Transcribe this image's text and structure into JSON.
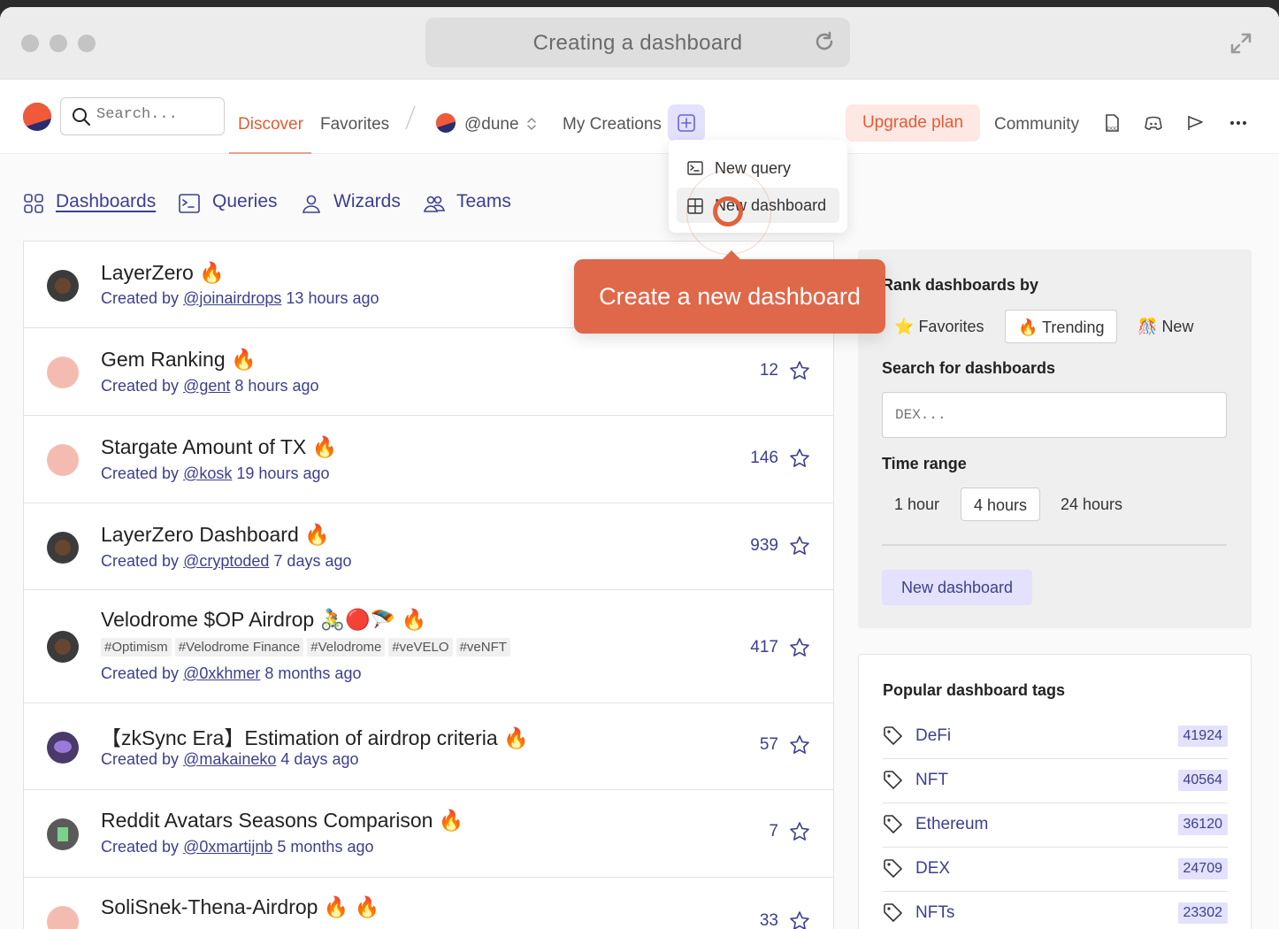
{
  "browser": {
    "title": "Creating a dashboard"
  },
  "nav": {
    "search_placeholder": "Search...",
    "discover": "Discover",
    "favorites": "Favorites",
    "team": "@dune",
    "my_creations": "My Creations",
    "upgrade": "Upgrade plan",
    "community": "Community"
  },
  "dropdown": {
    "items": [
      {
        "label": "New query",
        "icon": "terminal-icon"
      },
      {
        "label": "New dashboard",
        "icon": "grid-icon"
      }
    ]
  },
  "tooltip": {
    "text": "Create a new dashboard"
  },
  "tabs": [
    {
      "label": "Dashboards",
      "icon": "dashboards-icon",
      "active": true
    },
    {
      "label": "Queries",
      "icon": "queries-icon"
    },
    {
      "label": "Wizards",
      "icon": "user-icon"
    },
    {
      "label": "Teams",
      "icon": "team-icon"
    }
  ],
  "dashboards": [
    {
      "title": "LayerZero",
      "emoji": "🔥",
      "by": "Created by",
      "user": "@joinairdrops",
      "ago": "13 hours ago",
      "count": ""
    },
    {
      "title": "Gem Ranking",
      "emoji": "🔥",
      "by": "Created by",
      "user": "@gent",
      "ago": "8 hours ago",
      "count": "12"
    },
    {
      "title": "Stargate Amount of TX",
      "emoji": "🔥",
      "by": "Created by",
      "user": "@kosk",
      "ago": "19 hours ago",
      "count": "146"
    },
    {
      "title": "LayerZero Dashboard",
      "emoji": "🔥",
      "by": "Created by",
      "user": "@cryptoded",
      "ago": "7 days ago",
      "count": "939"
    },
    {
      "title": "Velodrome $OP Airdrop",
      "emoji": "🚴🔴🪂 🔥",
      "tags": [
        "#Optimism",
        "#Velodrome Finance",
        "#Velodrome",
        "#veVELO",
        "#veNFT"
      ],
      "by": "Created by",
      "user": "@0xkhmer",
      "ago": "8 months ago",
      "count": "417"
    },
    {
      "title": "【zkSync Era】Estimation of airdrop criteria",
      "emoji": "🔥",
      "by": "Created by",
      "user": "@makaineko",
      "ago": "4 days ago",
      "count": "57"
    },
    {
      "title": "Reddit Avatars Seasons Comparison",
      "emoji": "🔥",
      "by": "Created by",
      "user": "@0xmartijnb",
      "ago": "5 months ago",
      "count": "7"
    },
    {
      "title": "SoliSnek-Thena-Airdrop",
      "emoji": "🔥 🔥",
      "by": "",
      "user": "",
      "ago": "",
      "count": "33"
    }
  ],
  "rank": {
    "label": "Rank dashboards by",
    "options": [
      {
        "label": "Favorites",
        "emoji": "⭐"
      },
      {
        "label": "Trending",
        "emoji": "🔥"
      },
      {
        "label": "New",
        "emoji": "🎊"
      }
    ],
    "search_label": "Search for dashboards",
    "search_placeholder": "DEX...",
    "time_label": "Time range",
    "time_options": [
      "1 hour",
      "4 hours",
      "24 hours"
    ],
    "new_dashboard": "New dashboard"
  },
  "popular": {
    "title": "Popular dashboard tags",
    "tags": [
      {
        "name": "DeFi",
        "count": "41924"
      },
      {
        "name": "NFT",
        "count": "40564"
      },
      {
        "name": "Ethereum",
        "count": "36120"
      },
      {
        "name": "DEX",
        "count": "24709"
      },
      {
        "name": "NFTs",
        "count": "23302"
      }
    ]
  },
  "colors": {
    "accent": "#e25c35",
    "link": "#3c3f8f",
    "highlight": "#e3e1fb"
  }
}
